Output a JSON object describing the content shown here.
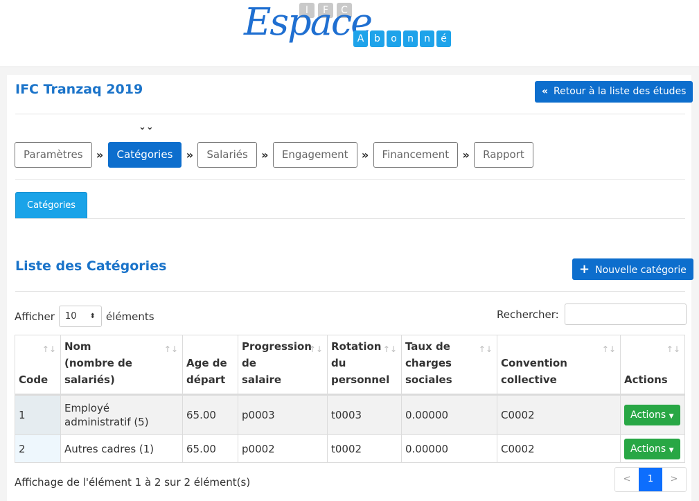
{
  "logo": {
    "ifc": [
      "I",
      "F",
      "C"
    ],
    "espace": "Espace",
    "abonne": [
      "A",
      "b",
      "o",
      "n",
      "n",
      "é"
    ]
  },
  "page": {
    "title": "IFC Tranzaq 2019",
    "back_label": "Retour à la liste des études",
    "back_icon": "«"
  },
  "steps": [
    {
      "label": "Paramètres"
    },
    {
      "label": "Catégories",
      "active": true
    },
    {
      "label": "Salariés"
    },
    {
      "label": "Engagement"
    },
    {
      "label": "Financement"
    },
    {
      "label": "Rapport"
    }
  ],
  "step_arrow": "»",
  "current_marker": "⌄⌄",
  "tab": "Catégories",
  "list": {
    "title": "Liste des Catégories",
    "new_label": "Nouvelle catégorie",
    "new_icon": "+"
  },
  "length": {
    "prefix": "Afficher",
    "value": "10",
    "suffix": "éléments"
  },
  "search": {
    "label": "Rechercher:",
    "value": ""
  },
  "table": {
    "headers": [
      "Code",
      "Nom\n(nombre de\nsalariés)",
      "Age de\ndépart",
      "Progression\nde\nsalaire",
      "Rotation\ndu\npersonnel",
      "Taux de\ncharges\nsociales",
      "Convention\ncollective",
      "Actions"
    ],
    "rows": [
      [
        "1",
        "Employé administratif (5)",
        "65.00",
        "p0003",
        "t0003",
        "0.00000",
        "C0002",
        "Actions"
      ],
      [
        "2",
        "Autres cadres (1)",
        "65.00",
        "p0002",
        "t0002",
        "0.00000",
        "C0002",
        "Actions"
      ]
    ]
  },
  "info": "Affichage de l'élément 1 à 2 sur 2 élément(s)",
  "pagination": {
    "prev": "<",
    "current": "1",
    "next": ">"
  },
  "colors": {
    "primary": "#0d6ecd",
    "tab": "#1aa3e8",
    "success": "#28a745",
    "title": "#1a73c9"
  }
}
